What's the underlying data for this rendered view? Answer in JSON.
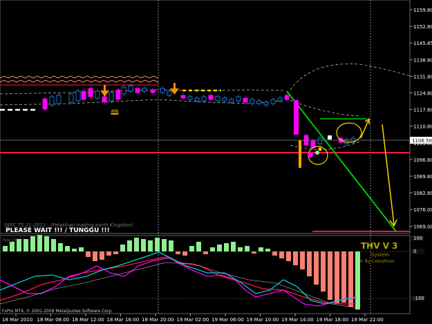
{
  "platform": {
    "copyright": "FxPro MT4, © 2001-2009 MetaQuotes Software Corp."
  },
  "main_chart": {
    "price_labels": [
      "1159.80",
      "1152.80",
      "1145.85",
      "1138.80",
      "1131.80",
      "1124.80",
      "1117.80",
      "1110.80",
      "1103.80",
      "1096.80",
      "1089.80",
      "1082.80",
      "1076.00",
      "1069.00"
    ],
    "current_price": "1106.50",
    "current_price_color": "#ffffff",
    "time_labels": [
      "18 Mar 2010",
      "18 Mar 08:00",
      "18 Mar 12:00",
      "18 Mar 16:00",
      "18 Mar 20:00",
      "19 Mar 02:00",
      "19 Mar 06:00",
      "19 Mar 10:00",
      "19 Mar 14:00",
      "19 Mar 18:00",
      "19 Mar 22:00"
    ],
    "overlay_text": "SEFC TS 11-2011 . (Pelatihan trading earth Kingdom)",
    "status_text": "PLEASE WAIT !!! / TUNGGU !!!",
    "colors": {
      "bull_candle": "#1e90ff",
      "bear_candle": "#ff00ff",
      "trend_line": "#00cc00",
      "support_line": "#ff1744",
      "target_line": "#ff1744",
      "arrow": "#ffd700",
      "upper_band": "#ffffff",
      "zigzag": "#ff8c69"
    }
  },
  "indicator": {
    "title": "THV V 3",
    "subtitle": "System",
    "credit": "© By Cobraforex",
    "level_labels": [
      "100",
      "0",
      "-100"
    ],
    "indicator_label": "THV COG",
    "colors": {
      "positive_bar": "#90ee90",
      "negative_bar": "#fa8072",
      "title": "#b8a400",
      "line_red": "#ff1744",
      "line_magenta": "#ff00ff",
      "line_cyan": "#00ced1"
    }
  }
}
